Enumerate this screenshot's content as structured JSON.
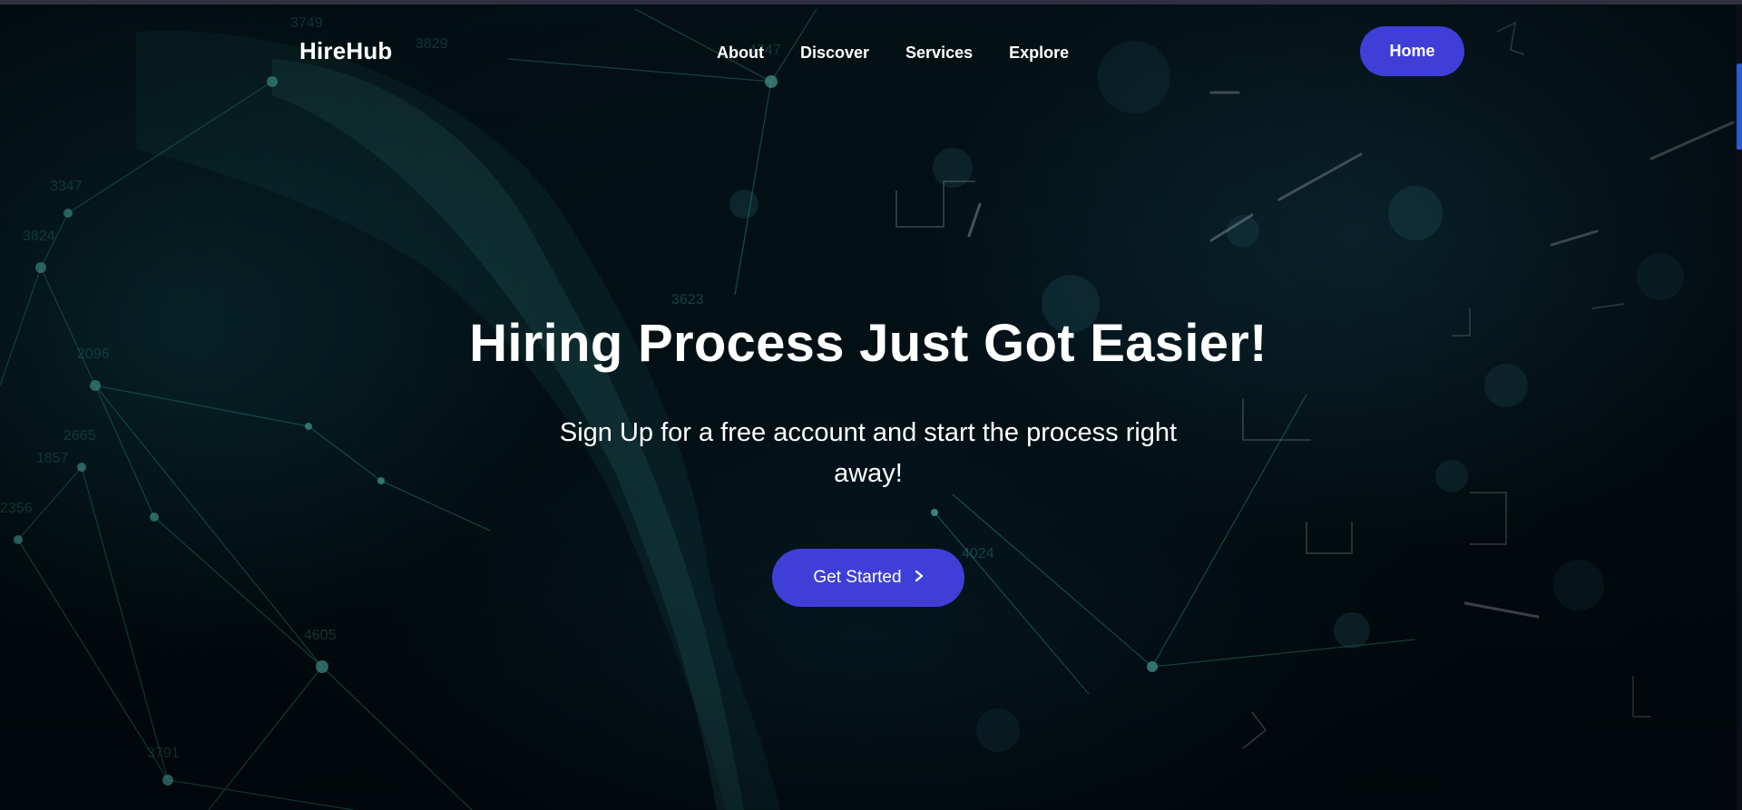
{
  "nav": {
    "brand": "HireHub",
    "links": [
      "About",
      "Discover",
      "Services",
      "Explore"
    ],
    "home_button": "Home"
  },
  "hero": {
    "headline": "Hiring Process Just Got Easier!",
    "subtext": "Sign Up for a free account and start the process right away!",
    "cta_label": "Get Started",
    "cta_icon": "chevron-right-icon",
    "background": "network-plexus-image"
  },
  "colors": {
    "accent": "#3f3fd8",
    "text": "#ffffff",
    "background": "#020c12",
    "network": "#3fb8b0"
  },
  "background_numbers": [
    "3749",
    "3829",
    "4747",
    "3347",
    "3824",
    "2096",
    "2665",
    "1857",
    "2356",
    "4605",
    "3791",
    "3623",
    "4024"
  ]
}
